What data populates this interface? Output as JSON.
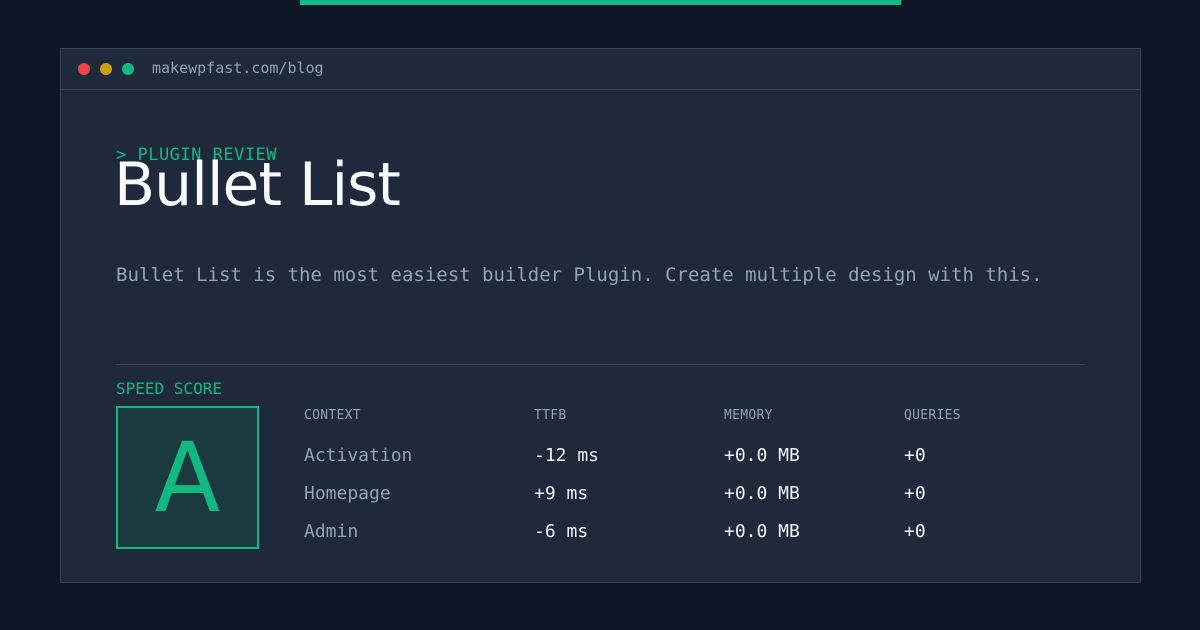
{
  "browser": {
    "url": "makewpfast.com/blog"
  },
  "header": {
    "eyebrow": "> PLUGIN REVIEW",
    "title": "Bullet List",
    "description": "Bullet List is the most easiest builder Plugin. Create multiple design with this."
  },
  "score": {
    "label": "SPEED SCORE",
    "grade": "A"
  },
  "table": {
    "columns": [
      "CONTEXT",
      "TTFB",
      "MEMORY",
      "QUERIES"
    ],
    "rows": [
      {
        "context": "Activation",
        "ttfb": "-12 ms",
        "memory": "+0.0 MB",
        "queries": "+0"
      },
      {
        "context": "Homepage",
        "ttfb": "+9 ms",
        "memory": "+0.0 MB",
        "queries": "+0"
      },
      {
        "context": "Admin",
        "ttfb": "-6 ms",
        "memory": "+0.0 MB",
        "queries": "+0"
      }
    ]
  },
  "colors": {
    "accent": "#10b981",
    "background": "#0e1628",
    "panel": "#1e293b"
  }
}
